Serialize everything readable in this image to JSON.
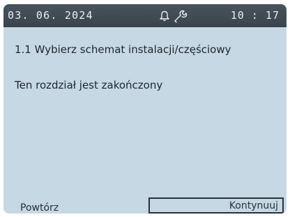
{
  "status_bar": {
    "date": "03. 06. 2024",
    "time": "10 : 17",
    "icons": [
      "bell-icon",
      "wrench-icon"
    ]
  },
  "content": {
    "step_title": "1.1 Wybierz schemat instalacji/częściowy",
    "message": "Ten rozdział jest zakończony"
  },
  "buttons": {
    "repeat_label": "Powtórz",
    "continue_label": "Kontynuuj"
  },
  "colors": {
    "screen_background": "#c5d8e3",
    "status_bar_background": "#3f4a53",
    "text": "#1f262d"
  }
}
